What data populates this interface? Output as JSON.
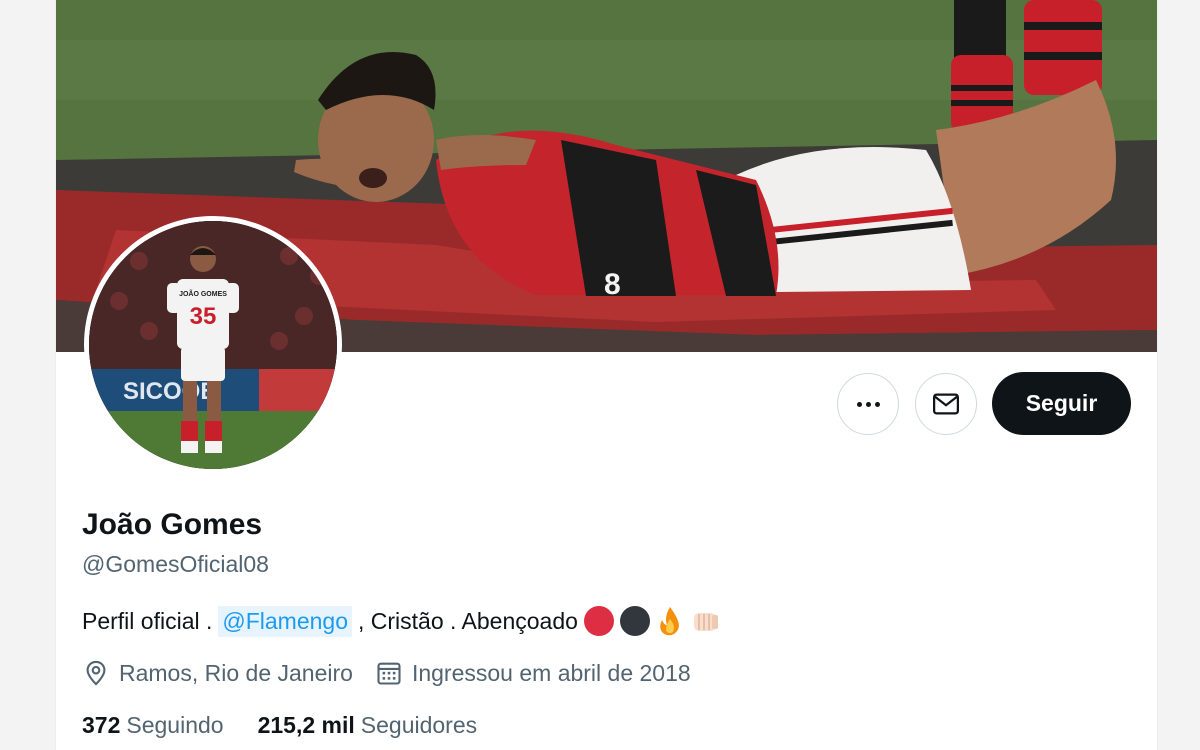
{
  "profile": {
    "name": "João Gomes",
    "handle": "@GomesOficial08",
    "bio_prefix": "Perfil oficial .",
    "bio_mention": "@Flamengo",
    "bio_suffix": ", Cristão . Abençoado",
    "location": "Ramos, Rio de Janeiro",
    "joined": "Ingressou em abril de 2018"
  },
  "actions": {
    "follow_label": "Seguir",
    "more_icon": "more-icon",
    "message_icon": "envelope-icon"
  },
  "stats": {
    "following_count": "372",
    "following_label": "Seguindo",
    "followers_count": "215,2 mil",
    "followers_label": "Seguidores"
  },
  "colors": {
    "accent": "#1d9bf0",
    "follow_bg": "#0f1419",
    "secondary_text": "#536471"
  },
  "banner": {
    "jersey_number": "8"
  },
  "avatar": {
    "jersey_name": "JOÃO GOMES",
    "jersey_number": "35",
    "board_text": "SICOOB"
  }
}
